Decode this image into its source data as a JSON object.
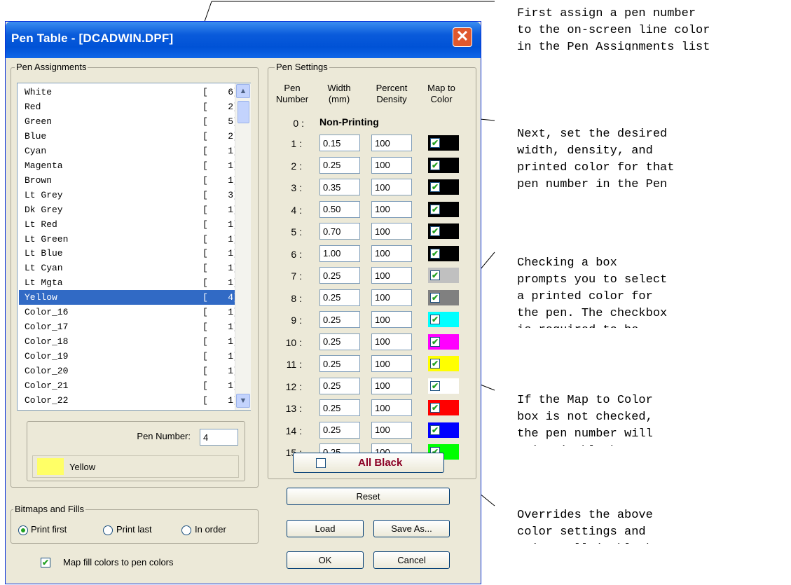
{
  "dialog": {
    "title": "Pen Table - [DCADWIN.DPF]",
    "close_glyph": "✕"
  },
  "pen_assignments": {
    "label": "Pen Assignments",
    "items": [
      {
        "name": "White",
        "pen": "6"
      },
      {
        "name": "Red",
        "pen": "2"
      },
      {
        "name": "Green",
        "pen": "5"
      },
      {
        "name": "Blue",
        "pen": "2"
      },
      {
        "name": "Cyan",
        "pen": "1"
      },
      {
        "name": "Magenta",
        "pen": "1"
      },
      {
        "name": "Brown",
        "pen": "1"
      },
      {
        "name": "Lt Grey",
        "pen": "3"
      },
      {
        "name": "Dk Grey",
        "pen": "1"
      },
      {
        "name": "Lt Red",
        "pen": "1"
      },
      {
        "name": "Lt Green",
        "pen": "1"
      },
      {
        "name": "Lt Blue",
        "pen": "1"
      },
      {
        "name": "Lt Cyan",
        "pen": "1"
      },
      {
        "name": "Lt Mgta",
        "pen": "1"
      },
      {
        "name": "Yellow",
        "pen": "4"
      },
      {
        "name": "Color_16",
        "pen": "1"
      },
      {
        "name": "Color_17",
        "pen": "1"
      },
      {
        "name": "Color_18",
        "pen": "1"
      },
      {
        "name": "Color_19",
        "pen": "1"
      },
      {
        "name": "Color_20",
        "pen": "1"
      },
      {
        "name": "Color_21",
        "pen": "1"
      },
      {
        "name": "Color_22",
        "pen": "1"
      }
    ],
    "selected_name": "Yellow",
    "pen_number_label": "Pen Number:",
    "pen_number_value": "4",
    "color_name": "Yellow",
    "color_swatch": "#ffff66"
  },
  "pen_settings": {
    "label": "Pen Settings",
    "headers": {
      "pen": "Pen\nNumber",
      "width": "Width\n(mm)",
      "density": "Percent\nDensity",
      "map": "Map to\nColor"
    },
    "zero_num": "0 :",
    "non_printing": "Non-Printing",
    "rows": [
      {
        "num": "1 :",
        "width": "0.15",
        "density": "100",
        "checked": true,
        "color": "#000000"
      },
      {
        "num": "2 :",
        "width": "0.25",
        "density": "100",
        "checked": true,
        "color": "#000000"
      },
      {
        "num": "3 :",
        "width": "0.35",
        "density": "100",
        "checked": true,
        "color": "#000000"
      },
      {
        "num": "4 :",
        "width": "0.50",
        "density": "100",
        "checked": true,
        "color": "#000000"
      },
      {
        "num": "5 :",
        "width": "0.70",
        "density": "100",
        "checked": true,
        "color": "#000000"
      },
      {
        "num": "6 :",
        "width": "1.00",
        "density": "100",
        "checked": true,
        "color": "#000000"
      },
      {
        "num": "7 :",
        "width": "0.25",
        "density": "100",
        "checked": true,
        "color": "#c0c0c0"
      },
      {
        "num": "8 :",
        "width": "0.25",
        "density": "100",
        "checked": true,
        "color": "#808080"
      },
      {
        "num": "9 :",
        "width": "0.25",
        "density": "100",
        "checked": true,
        "color": "#00ffff"
      },
      {
        "num": "10 :",
        "width": "0.25",
        "density": "100",
        "checked": true,
        "color": "#ff00ff"
      },
      {
        "num": "11 :",
        "width": "0.25",
        "density": "100",
        "checked": true,
        "color": "#ffff00"
      },
      {
        "num": "12 :",
        "width": "0.25",
        "density": "100",
        "checked": true,
        "color": "#ffffff"
      },
      {
        "num": "13 :",
        "width": "0.25",
        "density": "100",
        "checked": true,
        "color": "#ff0000"
      },
      {
        "num": "14 :",
        "width": "0.25",
        "density": "100",
        "checked": true,
        "color": "#0000ff"
      },
      {
        "num": "15 :",
        "width": "0.25",
        "density": "100",
        "checked": true,
        "color": "#00ff00"
      }
    ],
    "all_black_label": "All Black",
    "all_black_color": "#8b0025"
  },
  "buttons": {
    "reset": "Reset",
    "load": "Load",
    "save_as": "Save As...",
    "ok": "OK",
    "cancel": "Cancel"
  },
  "bitmaps": {
    "label": "Bitmaps and Fills",
    "options": [
      "Print first",
      "Print last",
      "In order"
    ],
    "selected": "Print first"
  },
  "map_fill": {
    "label": "Map fill colors to pen colors",
    "checked": true
  },
  "annotations": [
    "First assign a pen number\nto the on-screen line color\nin the Pen Assignments list",
    "Next, set the desired\nwidth, density, and\nprinted color for that\npen number in the Pen",
    "Checking a box\nprompts you to select\na printed color for\nthe pen. The checkbox\nis required to be\nchecked",
    "If the Map to Color\nbox is not checked,\nthe pen number will\nprint in black",
    "Overrides the above\ncolor settings and\nprints all in black"
  ]
}
